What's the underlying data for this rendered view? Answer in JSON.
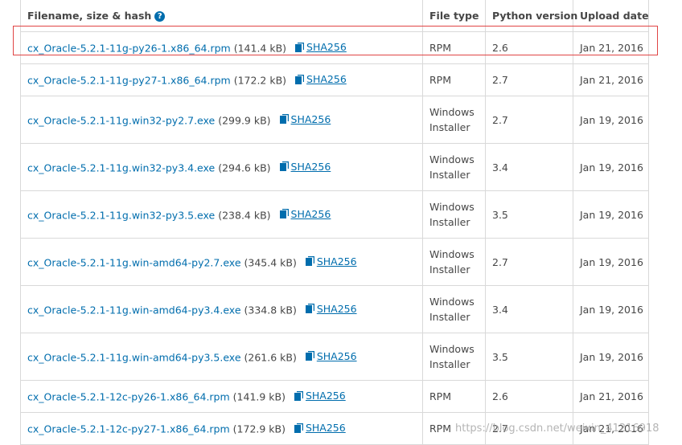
{
  "table": {
    "headers": {
      "filename": "Filename, size & hash",
      "file_type": "File type",
      "python_version": "Python version",
      "upload_date": "Upload date"
    },
    "hash_label": "SHA256",
    "rows": [
      {
        "file": "cx_Oracle-5.2.1-11g-py26-1.x86_64.rpm",
        "size": "(141.4 kB)",
        "type_line1": "RPM",
        "type_line2": "",
        "python": "2.6",
        "date": "Jan 21, 2016"
      },
      {
        "file": "cx_Oracle-5.2.1-11g-py27-1.x86_64.rpm",
        "size": "(172.2 kB)",
        "type_line1": "RPM",
        "type_line2": "",
        "python": "2.7",
        "date": "Jan 21, 2016"
      },
      {
        "file": "cx_Oracle-5.2.1-11g.win32-py2.7.exe",
        "size": "(299.9 kB)",
        "type_line1": "Windows",
        "type_line2": "Installer",
        "python": "2.7",
        "date": "Jan 19, 2016"
      },
      {
        "file": "cx_Oracle-5.2.1-11g.win32-py3.4.exe",
        "size": "(294.6 kB)",
        "type_line1": "Windows",
        "type_line2": "Installer",
        "python": "3.4",
        "date": "Jan 19, 2016"
      },
      {
        "file": "cx_Oracle-5.2.1-11g.win32-py3.5.exe",
        "size": "(238.4 kB)",
        "type_line1": "Windows",
        "type_line2": "Installer",
        "python": "3.5",
        "date": "Jan 19, 2016"
      },
      {
        "file": "cx_Oracle-5.2.1-11g.win-amd64-py2.7.exe",
        "size": "(345.4 kB)",
        "type_line1": "Windows",
        "type_line2": "Installer",
        "python": "2.7",
        "date": "Jan 19, 2016"
      },
      {
        "file": "cx_Oracle-5.2.1-11g.win-amd64-py3.4.exe",
        "size": "(334.8 kB)",
        "type_line1": "Windows",
        "type_line2": "Installer",
        "python": "3.4",
        "date": "Jan 19, 2016"
      },
      {
        "file": "cx_Oracle-5.2.1-11g.win-amd64-py3.5.exe",
        "size": "(261.6 kB)",
        "type_line1": "Windows",
        "type_line2": "Installer",
        "python": "3.5",
        "date": "Jan 19, 2016"
      },
      {
        "file": "cx_Oracle-5.2.1-12c-py26-1.x86_64.rpm",
        "size": "(141.9 kB)",
        "type_line1": "RPM",
        "type_line2": "",
        "python": "2.6",
        "date": "Jan 21, 2016"
      },
      {
        "file": "cx_Oracle-5.2.1-12c-py27-1.x86_64.rpm",
        "size": "(172.9 kB)",
        "type_line1": "RPM",
        "type_line2": "",
        "python": "2.7",
        "date": "Jan 21, 2016"
      }
    ]
  },
  "watermark": "https://blog.csdn.net/weixin_41216918",
  "colors": {
    "link": "#006dad",
    "text": "#464646",
    "border": "#d9d9d9",
    "highlight": "#e04444",
    "watermark": "#a8a8a8"
  },
  "icons": {
    "help": "question-circle-icon",
    "hash": "copy-icon"
  }
}
